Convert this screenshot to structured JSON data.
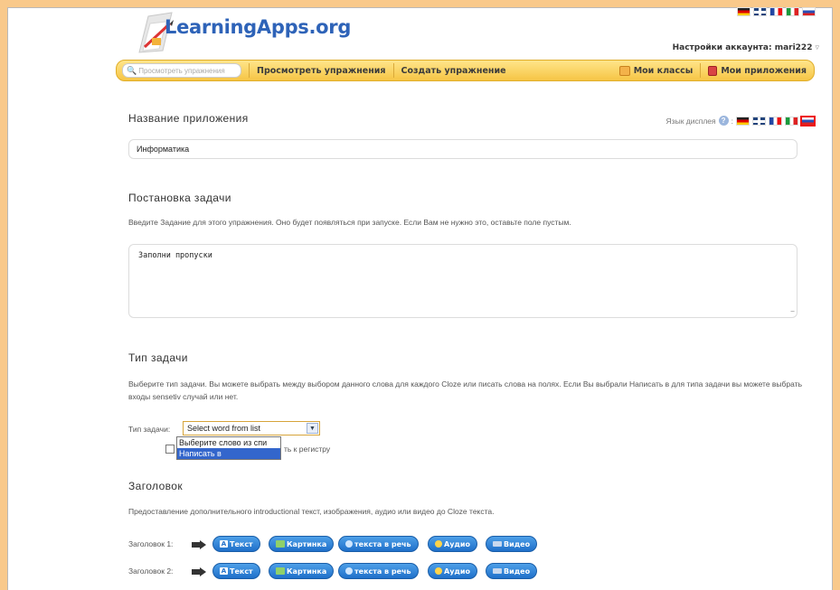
{
  "header": {
    "logo_text": "LearningApps.org",
    "account_label": "Настройки аккаунта: mari222",
    "account_chevron": "▿"
  },
  "navbar": {
    "search_placeholder": "Просмотреть упражнения",
    "browse": "Просмотреть упражнения",
    "create": "Создать упражнение",
    "my_classes": "Мои классы",
    "my_apps": "Мои приложения"
  },
  "app_name": {
    "title": "Название приложения",
    "language_label": "Язык дисплея",
    "help": "?",
    "value": "Информатика"
  },
  "task": {
    "title": "Постановка задачи",
    "description": "Введите Задание для этого упражнения. Оно будет появляться при запуске. Если Вам не нужно это, оставьте поле пустым.",
    "value": "Заполни пропуски"
  },
  "task_type": {
    "title": "Тип задачи",
    "description": "Выберите тип задачи. Вы можете выбрать между выбором данного слова для каждого Cloze или писать слова на полях. Если Вы выбрали Написать в для типа задачи вы можете выбрать входы sensetiv случай или нет.",
    "label": "Тип задачи:",
    "selected": "Select word from list",
    "options": [
      "Выберите слово из спи",
      "Написать в"
    ],
    "checkbox_label": "ть к регистру"
  },
  "heading": {
    "title": "Заголовок",
    "description": "Предоставление дополнительного introductional текст, изображения, аудио или видео до Cloze текста.",
    "rows": [
      {
        "label": "Заголовок 1:"
      },
      {
        "label": "Заголовок 2:"
      }
    ],
    "buttons": {
      "text": "Текст",
      "text_glyph": "A",
      "image": "Картинка",
      "tts": "текста в речь",
      "audio": "Аудио",
      "video": "Видео"
    }
  }
}
